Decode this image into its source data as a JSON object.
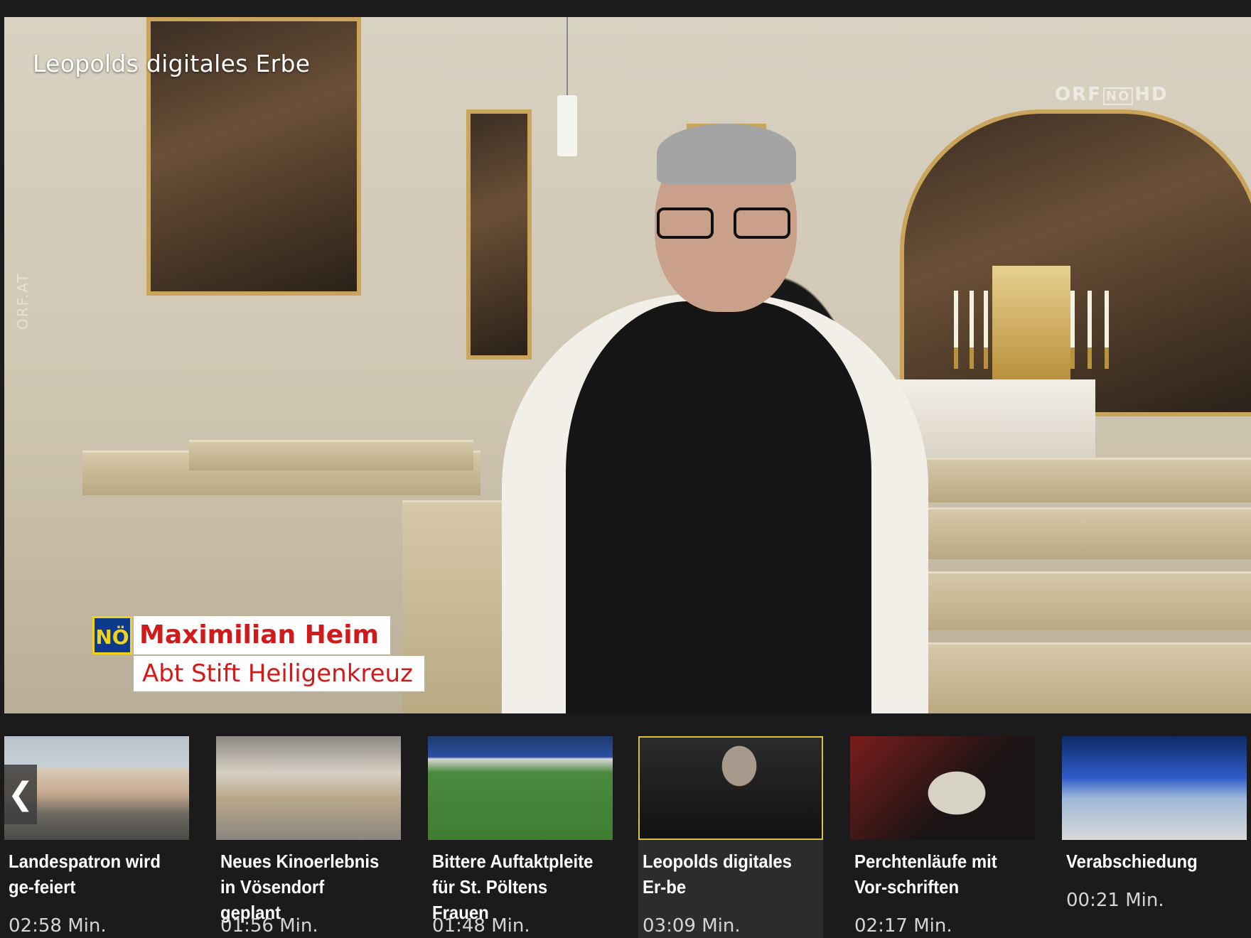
{
  "player": {
    "title": "Leopolds digitales Erbe",
    "channel_logo_orf": "ORF",
    "channel_logo_region": "NÖ",
    "channel_logo_hd": "HD",
    "watermark": "ORF.AT",
    "lower_third": {
      "badge": "NÖ",
      "name": "Maximilian Heim",
      "role": "Abt Stift Heiligenkreuz",
      "badge_color": "#0b3a8c",
      "text_color": "#d11a1a"
    }
  },
  "related": {
    "prev_icon": "chevron-left-icon",
    "prev_glyph": "❮",
    "items": [
      {
        "title": "Landespatron wird ge-feiert",
        "duration": "02:58 Min."
      },
      {
        "title": "Neues Kinoerlebnis in Vösendorf geplant",
        "duration": "01:56 Min."
      },
      {
        "title": "Bittere Auftaktpleite für St. Pöltens Frauen",
        "duration": "01:48 Min."
      },
      {
        "title": "Leopolds digitales Er-be",
        "duration": "03:09 Min.",
        "active": true
      },
      {
        "title": "Perchtenläufe mit Vor-schriften",
        "duration": "02:17 Min."
      },
      {
        "title": "Verabschiedung",
        "duration": "00:21 Min."
      }
    ]
  },
  "colors": {
    "active_border": "#d9c23a",
    "background": "#1b1b1b"
  }
}
